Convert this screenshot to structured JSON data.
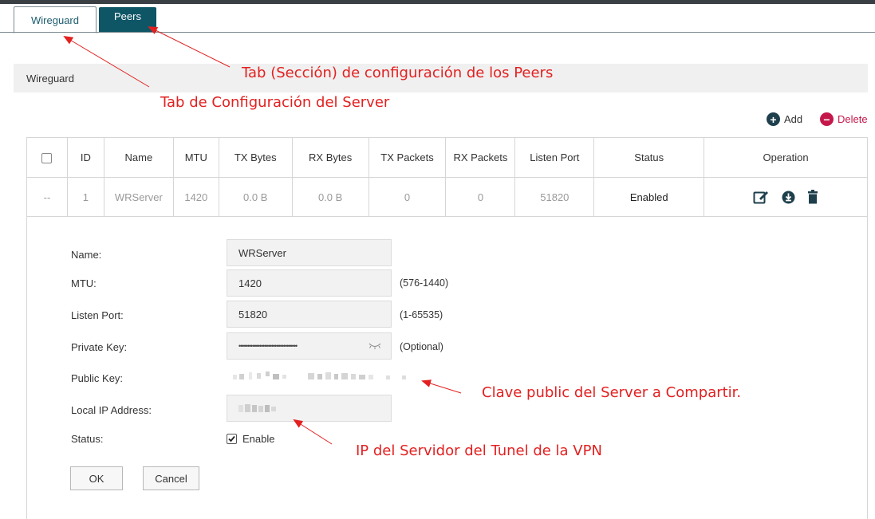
{
  "tabs": [
    {
      "label": "Wireguard",
      "active": true
    },
    {
      "label": "Peers",
      "active": false
    }
  ],
  "section_title": "Wireguard",
  "annotations": {
    "peers_tab": "Tab (Sección) de configuración de los Peers",
    "server_tab": "Tab de Configuración del Server",
    "public_key": "Clave public del Server a Compartir.",
    "local_ip": "IP del Servidor del Tunel de la VPN"
  },
  "toolbar": {
    "add_label": "Add",
    "delete_label": "Delete"
  },
  "table": {
    "headers": [
      "ID",
      "Name",
      "MTU",
      "TX Bytes",
      "RX Bytes",
      "TX Packets",
      "RX Packets",
      "Listen Port",
      "Status",
      "Operation"
    ],
    "rows": [
      {
        "select": "--",
        "id": "1",
        "name": "WRServer",
        "mtu": "1420",
        "tx_bytes": "0.0 B",
        "rx_bytes": "0.0 B",
        "tx_packets": "0",
        "rx_packets": "0",
        "listen_port": "51820",
        "status": "Enabled"
      }
    ]
  },
  "form": {
    "name_label": "Name:",
    "name_value": "WRServer",
    "mtu_label": "MTU:",
    "mtu_value": "1420",
    "mtu_hint": "(576-1440)",
    "port_label": "Listen Port:",
    "port_value": "51820",
    "port_hint": "(1-65535)",
    "private_key_label": "Private Key:",
    "private_key_value": "••••••••••••••••••••••••••••••••••",
    "private_key_hint": "(Optional)",
    "public_key_label": "Public Key:",
    "local_ip_label": "Local IP Address:",
    "status_label": "Status:",
    "enable_label": "Enable",
    "ok_label": "OK",
    "cancel_label": "Cancel"
  },
  "colors": {
    "accent": "#0e5566",
    "annotation": "#e32020",
    "delete": "#c4184a",
    "add": "#1e3f4c"
  }
}
